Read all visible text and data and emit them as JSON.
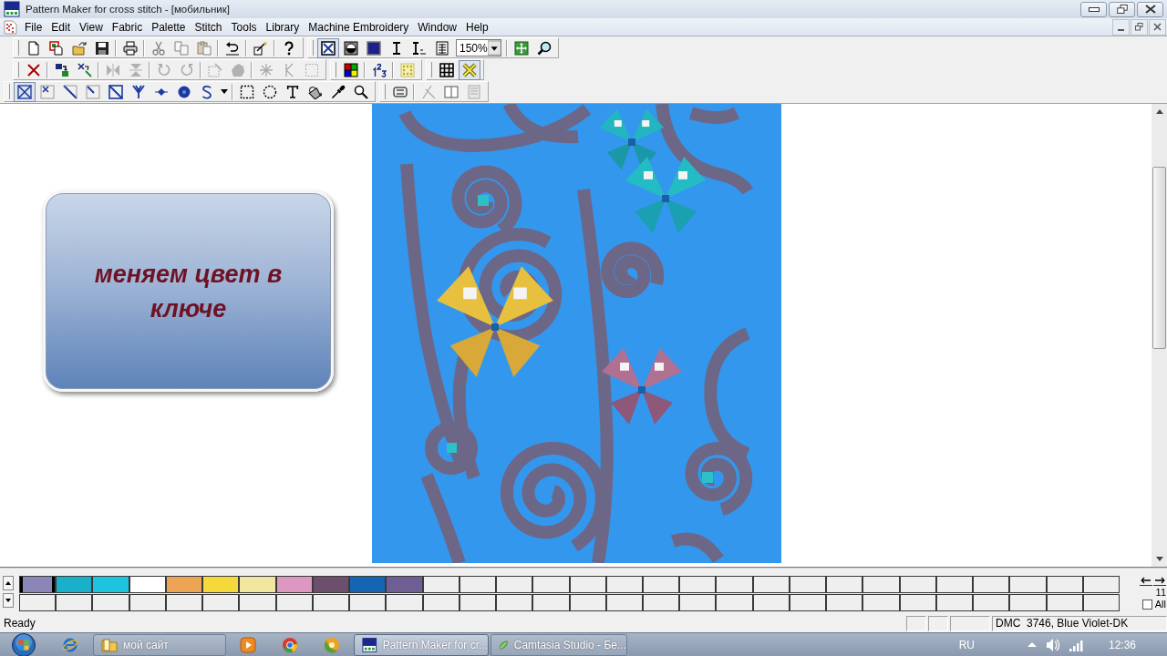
{
  "window": {
    "title": "Pattern Maker for cross stitch - [мобильник]"
  },
  "menu": {
    "items": [
      "File",
      "Edit",
      "View",
      "Fabric",
      "Palette",
      "Stitch",
      "Tools",
      "Library",
      "Machine Embroidery",
      "Window",
      "Help"
    ]
  },
  "toolbars": [
    {
      "groups": [
        {
          "items": [
            {
              "kind": "new",
              "pressed": false,
              "disabled": false
            },
            {
              "kind": "duplicate",
              "pressed": false,
              "disabled": false
            },
            {
              "kind": "open",
              "pressed": false,
              "disabled": false
            },
            {
              "kind": "save",
              "pressed": false,
              "disabled": false
            },
            {
              "kind": "separator"
            },
            {
              "kind": "print",
              "pressed": false,
              "disabled": false
            },
            {
              "kind": "separator"
            },
            {
              "kind": "cut",
              "pressed": false,
              "disabled": true
            },
            {
              "kind": "copy",
              "pressed": false,
              "disabled": true
            },
            {
              "kind": "paste",
              "pressed": false,
              "disabled": true
            },
            {
              "kind": "separator"
            },
            {
              "kind": "undo",
              "pressed": false,
              "disabled": false
            },
            {
              "kind": "separator"
            },
            {
              "kind": "wizard",
              "pressed": false,
              "disabled": false
            },
            {
              "kind": "separator"
            },
            {
              "kind": "help",
              "pressed": false,
              "disabled": false
            }
          ]
        },
        {
          "items": [
            {
              "kind": "crossview",
              "pressed": true,
              "disabled": false
            },
            {
              "kind": "fillview",
              "pressed": false,
              "disabled": false
            },
            {
              "kind": "block",
              "pressed": false,
              "disabled": false
            },
            {
              "kind": "letter",
              "pressed": false,
              "disabled": false
            },
            {
              "kind": "letterie",
              "pressed": false,
              "disabled": false
            },
            {
              "kind": "list",
              "pressed": false,
              "disabled": false
            },
            {
              "kind": "zoomselect",
              "value": "150%"
            },
            {
              "kind": "separator"
            },
            {
              "kind": "fit",
              "pressed": false,
              "disabled": false
            },
            {
              "kind": "zoom",
              "pressed": false,
              "disabled": false
            }
          ]
        }
      ]
    },
    {
      "groups": [
        {
          "items": [
            {
              "kind": "delete",
              "pressed": false,
              "disabled": false
            },
            {
              "kind": "separator"
            },
            {
              "kind": "swap",
              "pressed": false,
              "disabled": false
            },
            {
              "kind": "replace",
              "pressed": false,
              "disabled": false
            },
            {
              "kind": "separator"
            },
            {
              "kind": "fliph",
              "pressed": false,
              "disabled": true
            },
            {
              "kind": "flipv",
              "pressed": false,
              "disabled": true
            },
            {
              "kind": "separator"
            },
            {
              "kind": "rotl",
              "pressed": false,
              "disabled": true
            },
            {
              "kind": "rotr",
              "pressed": false,
              "disabled": true
            },
            {
              "kind": "separator"
            },
            {
              "kind": "selstitch",
              "pressed": false,
              "disabled": true
            },
            {
              "kind": "blob",
              "pressed": false,
              "disabled": true
            },
            {
              "kind": "separator"
            },
            {
              "kind": "star",
              "pressed": false,
              "disabled": true
            },
            {
              "kind": "branch",
              "pressed": false,
              "disabled": true
            },
            {
              "kind": "dashed",
              "pressed": false,
              "disabled": true
            }
          ]
        },
        {
          "items": [
            {
              "kind": "palette",
              "pressed": false,
              "disabled": false
            },
            {
              "kind": "separator"
            },
            {
              "kind": "numbers",
              "pressed": false,
              "disabled": false
            },
            {
              "kind": "separator"
            },
            {
              "kind": "dots",
              "pressed": false,
              "disabled": false
            }
          ]
        },
        {
          "items": [
            {
              "kind": "grid",
              "pressed": false,
              "disabled": false
            },
            {
              "kind": "ycross",
              "pressed": true,
              "disabled": false
            }
          ]
        }
      ]
    },
    {
      "groups": [
        {
          "items": [
            {
              "kind": "full",
              "pressed": true,
              "disabled": false
            },
            {
              "kind": "quarter",
              "pressed": false,
              "disabled": false
            },
            {
              "kind": "half",
              "pressed": false,
              "disabled": false
            },
            {
              "kind": "threeq",
              "pressed": false,
              "disabled": false
            },
            {
              "kind": "diag",
              "pressed": false,
              "disabled": false
            },
            {
              "kind": "fork",
              "pressed": false,
              "disabled": false
            },
            {
              "kind": "beadsmall",
              "pressed": false,
              "disabled": false
            },
            {
              "kind": "bead",
              "pressed": false,
              "disabled": false
            },
            {
              "kind": "sletter",
              "pressed": false,
              "disabled": false
            },
            {
              "kind": "caret",
              "pressed": false,
              "disabled": false
            },
            {
              "kind": "separator"
            },
            {
              "kind": "selrect",
              "pressed": false,
              "disabled": false
            },
            {
              "kind": "lasso",
              "pressed": false,
              "disabled": false
            },
            {
              "kind": "text",
              "pressed": false,
              "disabled": false
            },
            {
              "kind": "bucket",
              "pressed": false,
              "disabled": false
            },
            {
              "kind": "dropper",
              "pressed": false,
              "disabled": false
            },
            {
              "kind": "magnify",
              "pressed": false,
              "disabled": false
            }
          ]
        },
        {
          "items": [
            {
              "kind": "machine",
              "pressed": false,
              "disabled": false
            },
            {
              "kind": "separator"
            },
            {
              "kind": "stitchx",
              "pressed": false,
              "disabled": true
            },
            {
              "kind": "split",
              "pressed": false,
              "disabled": false
            },
            {
              "kind": "pages",
              "pressed": false,
              "disabled": true
            }
          ]
        }
      ]
    }
  ],
  "canvas": {
    "callout": "меняем цвет в ключе"
  },
  "palette": {
    "swatches": [
      {
        "color": "#8a86b6",
        "selected": true
      },
      {
        "color": "#1ab0cc",
        "selected": false
      },
      {
        "color": "#1ec3e0",
        "selected": false
      },
      {
        "color": "#ffffff",
        "selected": false
      },
      {
        "color": "#eda455",
        "selected": false
      },
      {
        "color": "#f5d83a",
        "selected": false
      },
      {
        "color": "#f0e6a0",
        "selected": false
      },
      {
        "color": "#dc98c0",
        "selected": false
      },
      {
        "color": "#6b4f6c",
        "selected": false
      },
      {
        "color": "#1466b4",
        "selected": false
      },
      {
        "color": "#6e5e94",
        "selected": false
      },
      {
        "selected": false
      },
      {
        "selected": false
      },
      {
        "selected": false
      },
      {
        "selected": false
      },
      {
        "selected": false
      },
      {
        "selected": false
      },
      {
        "selected": false
      },
      {
        "selected": false
      },
      {
        "selected": false
      },
      {
        "selected": false
      },
      {
        "selected": false
      },
      {
        "selected": false
      },
      {
        "selected": false
      },
      {
        "selected": false
      },
      {
        "selected": false
      },
      {
        "selected": false
      },
      {
        "selected": false
      },
      {
        "selected": false
      },
      {
        "selected": false
      },
      {
        "selected": false
      },
      {
        "selected": false
      },
      {
        "selected": false
      },
      {
        "selected": false
      },
      {
        "selected": false
      },
      {
        "selected": false
      },
      {
        "selected": false
      },
      {
        "selected": false
      },
      {
        "selected": false
      },
      {
        "selected": false
      },
      {
        "selected": false
      },
      {
        "selected": false
      },
      {
        "selected": false
      },
      {
        "selected": false
      },
      {
        "selected": false
      },
      {
        "selected": false
      },
      {
        "selected": false
      },
      {
        "selected": false
      },
      {
        "selected": false
      },
      {
        "selected": false
      },
      {
        "selected": false
      },
      {
        "selected": false
      },
      {
        "selected": false
      },
      {
        "selected": false
      },
      {
        "selected": false
      },
      {
        "selected": false
      },
      {
        "selected": false
      },
      {
        "selected": false
      },
      {
        "selected": false
      },
      {
        "selected": false
      }
    ],
    "count": "11",
    "all": {
      "label": "All",
      "checked": false
    }
  },
  "status_bar": {
    "message": "Ready",
    "color_info": "DMC  3746, Blue Violet-DK"
  },
  "taskbar": {
    "items": [
      {
        "kind": "start",
        "selected": false
      },
      {
        "kind": "browser",
        "selected": false
      },
      {
        "kind": "folder",
        "label": "мой сайт",
        "selected": false
      },
      {
        "kind": "player",
        "selected": false
      },
      {
        "kind": "globe",
        "selected": false
      },
      {
        "kind": "ball",
        "selected": false
      },
      {
        "kind": "app",
        "label": "Pattern Maker for cr...",
        "selected": true
      },
      {
        "kind": "recorder",
        "label": "Camtasia Studio - Бе...",
        "selected": false
      }
    ],
    "language": "RU",
    "time": "12:36"
  }
}
